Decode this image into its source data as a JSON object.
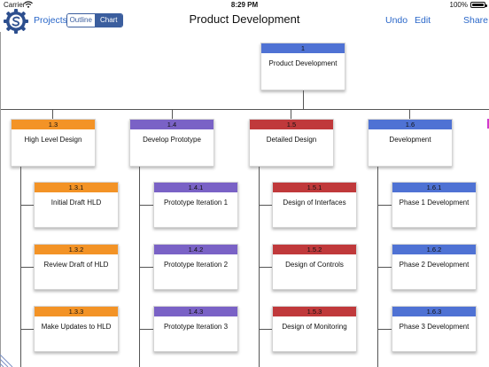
{
  "status_bar": {
    "carrier": "Carrier",
    "time": "8:29 PM",
    "battery": "100%"
  },
  "nav": {
    "projects_label": "Projects",
    "segments": {
      "outline": "Outline",
      "chart": "Chart",
      "selected": "Chart"
    },
    "title": "Product Development",
    "undo_label": "Undo",
    "edit_label": "Edit",
    "share_label": "Share"
  },
  "colors": {
    "blue": "#4f72d4",
    "orange": "#f39326",
    "purple": "#7a62c6",
    "red": "#c0393b",
    "magenta": "#d03ad0",
    "accent": "#2a67c9"
  },
  "tree": {
    "root": {
      "id": "1",
      "title": "Product Development",
      "color": "blue"
    },
    "branches": [
      {
        "id": "1.3",
        "title": "High Level Design",
        "color": "orange",
        "children": [
          {
            "id": "1.3.1",
            "title": "Initial Draft HLD"
          },
          {
            "id": "1.3.2",
            "title": "Review Draft of HLD"
          },
          {
            "id": "1.3.3",
            "title": "Make Updates to HLD"
          }
        ]
      },
      {
        "id": "1.4",
        "title": "Develop Prototype",
        "color": "purple",
        "children": [
          {
            "id": "1.4.1",
            "title": "Prototype Iteration 1"
          },
          {
            "id": "1.4.2",
            "title": "Prototype Iteration 2"
          },
          {
            "id": "1.4.3",
            "title": "Prototype Iteration 3"
          }
        ]
      },
      {
        "id": "1.5",
        "title": "Detailed Design",
        "color": "red",
        "children": [
          {
            "id": "1.5.1",
            "title": "Design of Interfaces"
          },
          {
            "id": "1.5.2",
            "title": "Design of Controls"
          },
          {
            "id": "1.5.3",
            "title": "Design of Monitoring"
          }
        ]
      },
      {
        "id": "1.6",
        "title": "Development",
        "color": "blue",
        "children": [
          {
            "id": "1.6.1",
            "title": "Phase 1 Development"
          },
          {
            "id": "1.6.2",
            "title": "Phase 2 Development"
          },
          {
            "id": "1.6.3",
            "title": "Phase 3 Development"
          }
        ]
      }
    ]
  }
}
